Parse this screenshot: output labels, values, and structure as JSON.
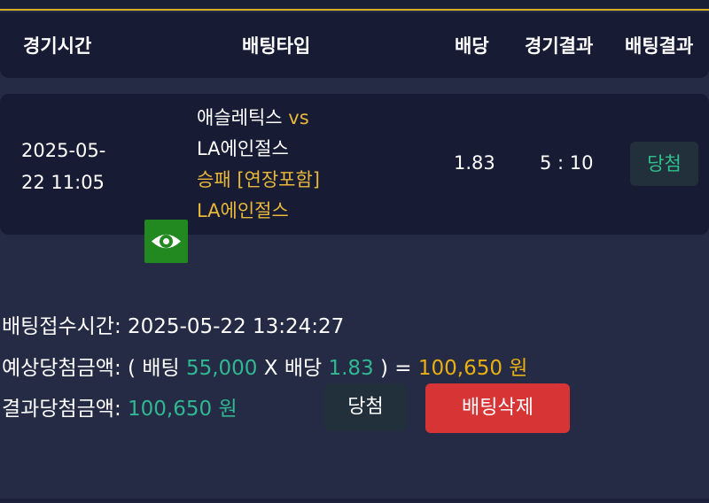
{
  "header": {
    "time": "경기시간",
    "bet_type": "배팅타입",
    "odds": "배당",
    "game_result": "경기결과",
    "bet_result": "배팅결과"
  },
  "bet_row": {
    "time_date": "2025-05-",
    "time_clock": "22 11:05",
    "icon": "eye-icon",
    "home_team": "애슬레틱스",
    "vs": "vs",
    "away_team": "LA에인절스",
    "market": "승패 [연장포함]",
    "pick": "LA에인절스",
    "odds": "1.83",
    "score": "5 : 10",
    "result_badge": "당첨"
  },
  "summary": {
    "bet_time_label": "배팅접수시간:",
    "bet_time_value": "2025-05-22 13:24:27",
    "expected_label": "예상당첨금액:",
    "expected_open": "( 배팅",
    "expected_stake": "55,000",
    "expected_x": "X 배당",
    "expected_odds": "1.83",
    "expected_close": ") =",
    "expected_amount": "100,650 원",
    "result_label": "결과당첨금액:",
    "result_amount": "100,650 원"
  },
  "actions": {
    "win_label": "당첨",
    "delete_label": "배팅삭제"
  },
  "colors": {
    "background": "#252a45",
    "panel": "#171b33",
    "accent_gold": "#e8b010",
    "accent_green": "#2fb891",
    "delete_red": "#d63435",
    "team_icon_green": "#21891f"
  }
}
